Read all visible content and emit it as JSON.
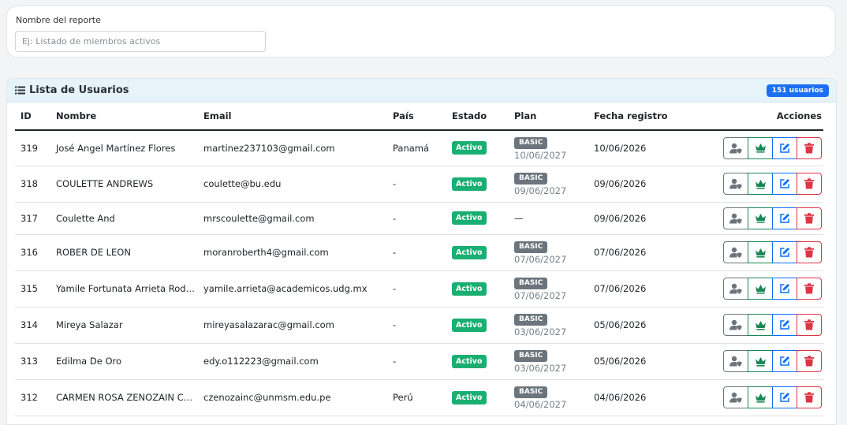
{
  "report": {
    "label": "Nombre del reporte",
    "placeholder": "Ej: Listado de miembros activos"
  },
  "users": {
    "title": "Lista de Usuarios",
    "count_badge": "151 usuarios",
    "columns": [
      "ID",
      "Nombre",
      "Email",
      "País",
      "Estado",
      "Plan",
      "Fecha registro",
      "Acciones"
    ],
    "rows": [
      {
        "id": "319",
        "name": "José Angel Martínez Flores",
        "email": "martinez237103@gmail.com",
        "country": "Panamá",
        "status": "Activo",
        "plan": "BASIC",
        "plan_date": "10/06/2027",
        "registered": "10/06/2026"
      },
      {
        "id": "318",
        "name": "COULETTE ANDREWS",
        "email": "coulette@bu.edu",
        "country": "-",
        "status": "Activo",
        "plan": "BASIC",
        "plan_date": "09/06/2027",
        "registered": "09/06/2026"
      },
      {
        "id": "317",
        "name": "Coulette And",
        "email": "mrscoulette@gmail.com",
        "country": "-",
        "status": "Activo",
        "plan": "",
        "plan_date": "—",
        "registered": "09/06/2026"
      },
      {
        "id": "316",
        "name": "ROBER DE LEON",
        "email": "moranroberth4@gmail.com",
        "country": "-",
        "status": "Activo",
        "plan": "BASIC",
        "plan_date": "07/06/2027",
        "registered": "07/06/2026"
      },
      {
        "id": "315",
        "name": "Yamile Fortunata Arrieta Rodríguez",
        "email": "yamile.arrieta@academicos.udg.mx",
        "country": "-",
        "status": "Activo",
        "plan": "BASIC",
        "plan_date": "07/06/2027",
        "registered": "07/06/2026"
      },
      {
        "id": "314",
        "name": "Mireya Salazar",
        "email": "mireyasalazarac@gmail.com",
        "country": "-",
        "status": "Activo",
        "plan": "BASIC",
        "plan_date": "03/06/2027",
        "registered": "05/06/2026"
      },
      {
        "id": "313",
        "name": "Edilma De Oro",
        "email": "edy.o112223@gmail.com",
        "country": "-",
        "status": "Activo",
        "plan": "BASIC",
        "plan_date": "03/06/2027",
        "registered": "05/06/2026"
      },
      {
        "id": "312",
        "name": "CARMEN ROSA ZENOZAIN COSSIO",
        "email": "czenozainc@unmsm.edu.pe",
        "country": "Perú",
        "status": "Activo",
        "plan": "BASIC",
        "plan_date": "04/06/2027",
        "registered": "04/06/2026"
      }
    ]
  },
  "icons": {
    "header": "list-icon",
    "actions": [
      "user-shield-icon",
      "crown-icon",
      "edit-icon",
      "trash-icon"
    ]
  },
  "colors": {
    "header_bg": "#e6f4fa",
    "count_badge": "#1c6ff3",
    "status_active": "#1aaf72",
    "plan_badge": "#6c757d",
    "action_user": "#6c757d",
    "action_crown": "#198754",
    "action_edit": "#0d6efd",
    "action_delete": "#dc3545"
  }
}
